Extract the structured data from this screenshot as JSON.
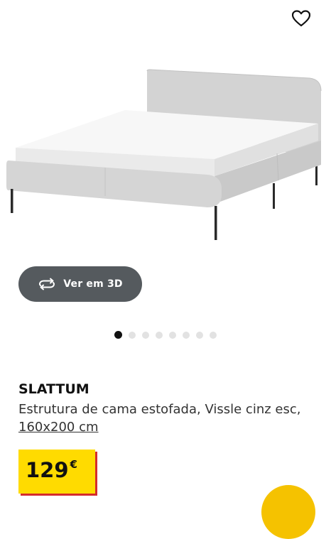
{
  "icons": {
    "favourite": "heart-icon",
    "view_3d": "rotate-3d-icon"
  },
  "view_3d_label": "Ver em 3D",
  "carousel": {
    "count": 8,
    "active": 1
  },
  "product": {
    "name": "SLATTUM",
    "description": "Estrutura de cama estofada, Vissle cinz esc,",
    "size": "160x200 cm",
    "price": "129",
    "currency": "€"
  },
  "colors": {
    "price_bg": "#ffdb00",
    "price_accent": "#d42c2c",
    "button_dark": "#555a5e"
  }
}
